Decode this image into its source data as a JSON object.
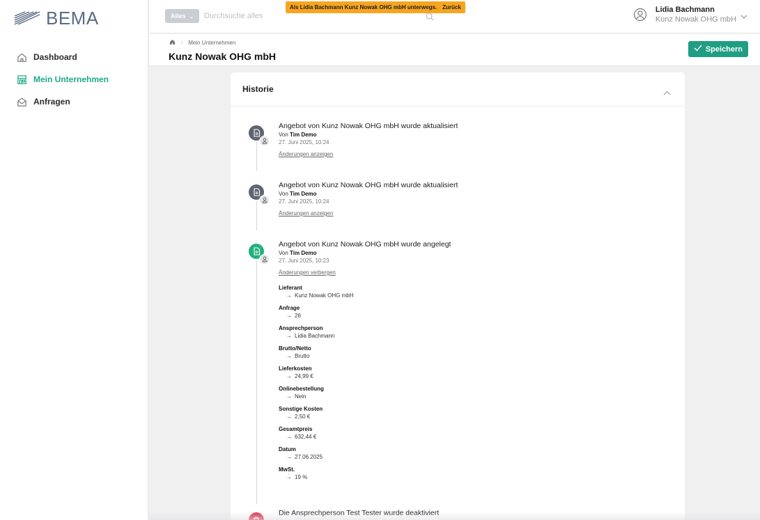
{
  "app": {
    "logo_text": "BEMA"
  },
  "sidebar": {
    "items": [
      {
        "label": "Dashboard",
        "icon": "home-icon",
        "active": false
      },
      {
        "label": "Mein Unternehmen",
        "icon": "store-icon",
        "active": true
      },
      {
        "label": "Anfragen",
        "icon": "mail-icon",
        "active": false
      }
    ]
  },
  "topbar": {
    "filter_label": "Alles",
    "search_placeholder": "Durchsuche alles",
    "impersonation_text": "Als Lidia Bachmann Kunz Nowak OHG mbH unterwegs.",
    "impersonation_back": "Zurück",
    "user_name": "Lidia Bachmann",
    "user_company": "Kunz Nowak OHG mbH"
  },
  "page": {
    "breadcrumb_current": "Mein Unternehmen",
    "title": "Kunz Nowak OHG mbH",
    "save_label": "Speichern"
  },
  "history": {
    "title": "Historie",
    "entries": [
      {
        "title": "Angebot von Kunz Nowak OHG mbH wurde aktualisiert",
        "by_prefix": "Von",
        "by_name": "Tim Demo",
        "date": "27. Juni 2025, 10:24",
        "toggle": "Änderungen anzeigen",
        "kind": "gray"
      },
      {
        "title": "Angebot von Kunz Nowak OHG mbH wurde aktualisiert",
        "by_prefix": "Von",
        "by_name": "Tim Demo",
        "date": "27. Juni 2025, 10:24",
        "toggle": "Änderungen anzeigen",
        "kind": "gray"
      },
      {
        "title": "Angebot von Kunz Nowak OHG mbH wurde angelegt",
        "by_prefix": "Von",
        "by_name": "Tim Demo",
        "date": "27. Juni 2025, 10:23",
        "toggle": "Änderungen verbergen",
        "kind": "green",
        "changes": [
          {
            "field": "Lieferant",
            "value": "Kunz Nowak OHG mbH"
          },
          {
            "field": "Anfrage",
            "value": "26"
          },
          {
            "field": "Ansprechperson",
            "value": "Lidia Bachmann"
          },
          {
            "field": "Brutto/Netto",
            "value": "Brutto"
          },
          {
            "field": "Lieferkosten",
            "value": "24,99 €"
          },
          {
            "field": "Onlinebestellung",
            "value": "Nein"
          },
          {
            "field": "Sonstige Kosten",
            "value": "2,50 €"
          },
          {
            "field": "Gesamtpreis",
            "value": "632,44 €"
          },
          {
            "field": "Datum",
            "value": "27.06.2025"
          },
          {
            "field": "MwSt.",
            "value": "19 %"
          }
        ]
      },
      {
        "title": "Die Ansprechperson Test Tester wurde deaktiviert",
        "kind": "red"
      }
    ]
  },
  "colors": {
    "accent": "#1f9e84",
    "warning": "#f7a51f",
    "danger": "#e0344f"
  }
}
